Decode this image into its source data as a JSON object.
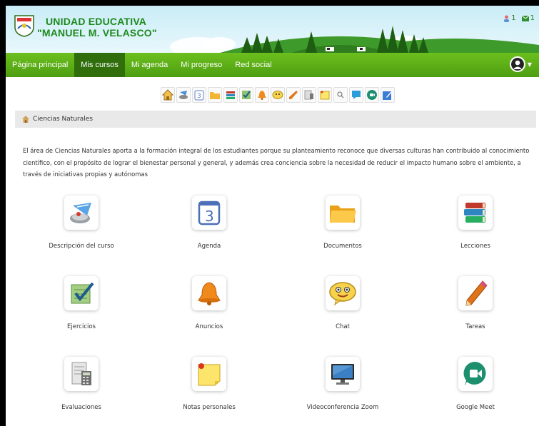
{
  "header": {
    "school_line1": "UNIDAD EDUCATIVA",
    "school_line2": "\"MANUEL M. VELASCO\"",
    "users_count": "1",
    "messages_count": "1",
    "colors": {
      "green": "#1e8a1e",
      "sky": "#c9ecf6"
    }
  },
  "nav": {
    "items": [
      {
        "label": "Página principal"
      },
      {
        "label": "Mis cursos"
      },
      {
        "label": "Mi agenda"
      },
      {
        "label": "Mi progreso"
      },
      {
        "label": "Red social"
      }
    ],
    "active_index": 1,
    "user_menu_icon": "avatar-icon"
  },
  "toolbar": {
    "icons": [
      "home-icon",
      "course-description-icon",
      "agenda-icon",
      "documents-icon",
      "lessons-icon",
      "exercises-icon",
      "announcements-icon",
      "chat-icon",
      "tasks-icon",
      "evaluations-icon",
      "notes-icon",
      "search-icon",
      "zoom-icon",
      "meet-icon",
      "edit-icon"
    ]
  },
  "breadcrumb": {
    "label": "Ciencias Naturales"
  },
  "description": "El área de Ciencias Naturales aporta a la formación integral de los estudiantes porque su planteamiento reconoce que diversas culturas han contribuido al conocimiento científico, con el propósito de lograr el bienestar personal y general, y además crea conciencia sobre la necesidad de reducir el impacto humano sobre el ambiente, a través de iniciativas propias y autónomas",
  "tools": [
    {
      "label": "Descripción del curso",
      "icon": "course-description-icon"
    },
    {
      "label": "Agenda",
      "icon": "calendar-icon"
    },
    {
      "label": "Documentos",
      "icon": "folder-icon"
    },
    {
      "label": "Lecciones",
      "icon": "books-icon"
    },
    {
      "label": "Ejercicios",
      "icon": "checklist-icon"
    },
    {
      "label": "Anuncios",
      "icon": "bell-icon"
    },
    {
      "label": "Chat",
      "icon": "chat-face-icon"
    },
    {
      "label": "Tareas",
      "icon": "pencil-icon"
    },
    {
      "label": "Evaluaciones",
      "icon": "calculator-icon"
    },
    {
      "label": "Notas personales",
      "icon": "sticky-note-icon"
    },
    {
      "label": "Videoconferencia Zoom",
      "icon": "monitor-icon"
    },
    {
      "label": "Google Meet",
      "icon": "google-meet-icon"
    }
  ]
}
